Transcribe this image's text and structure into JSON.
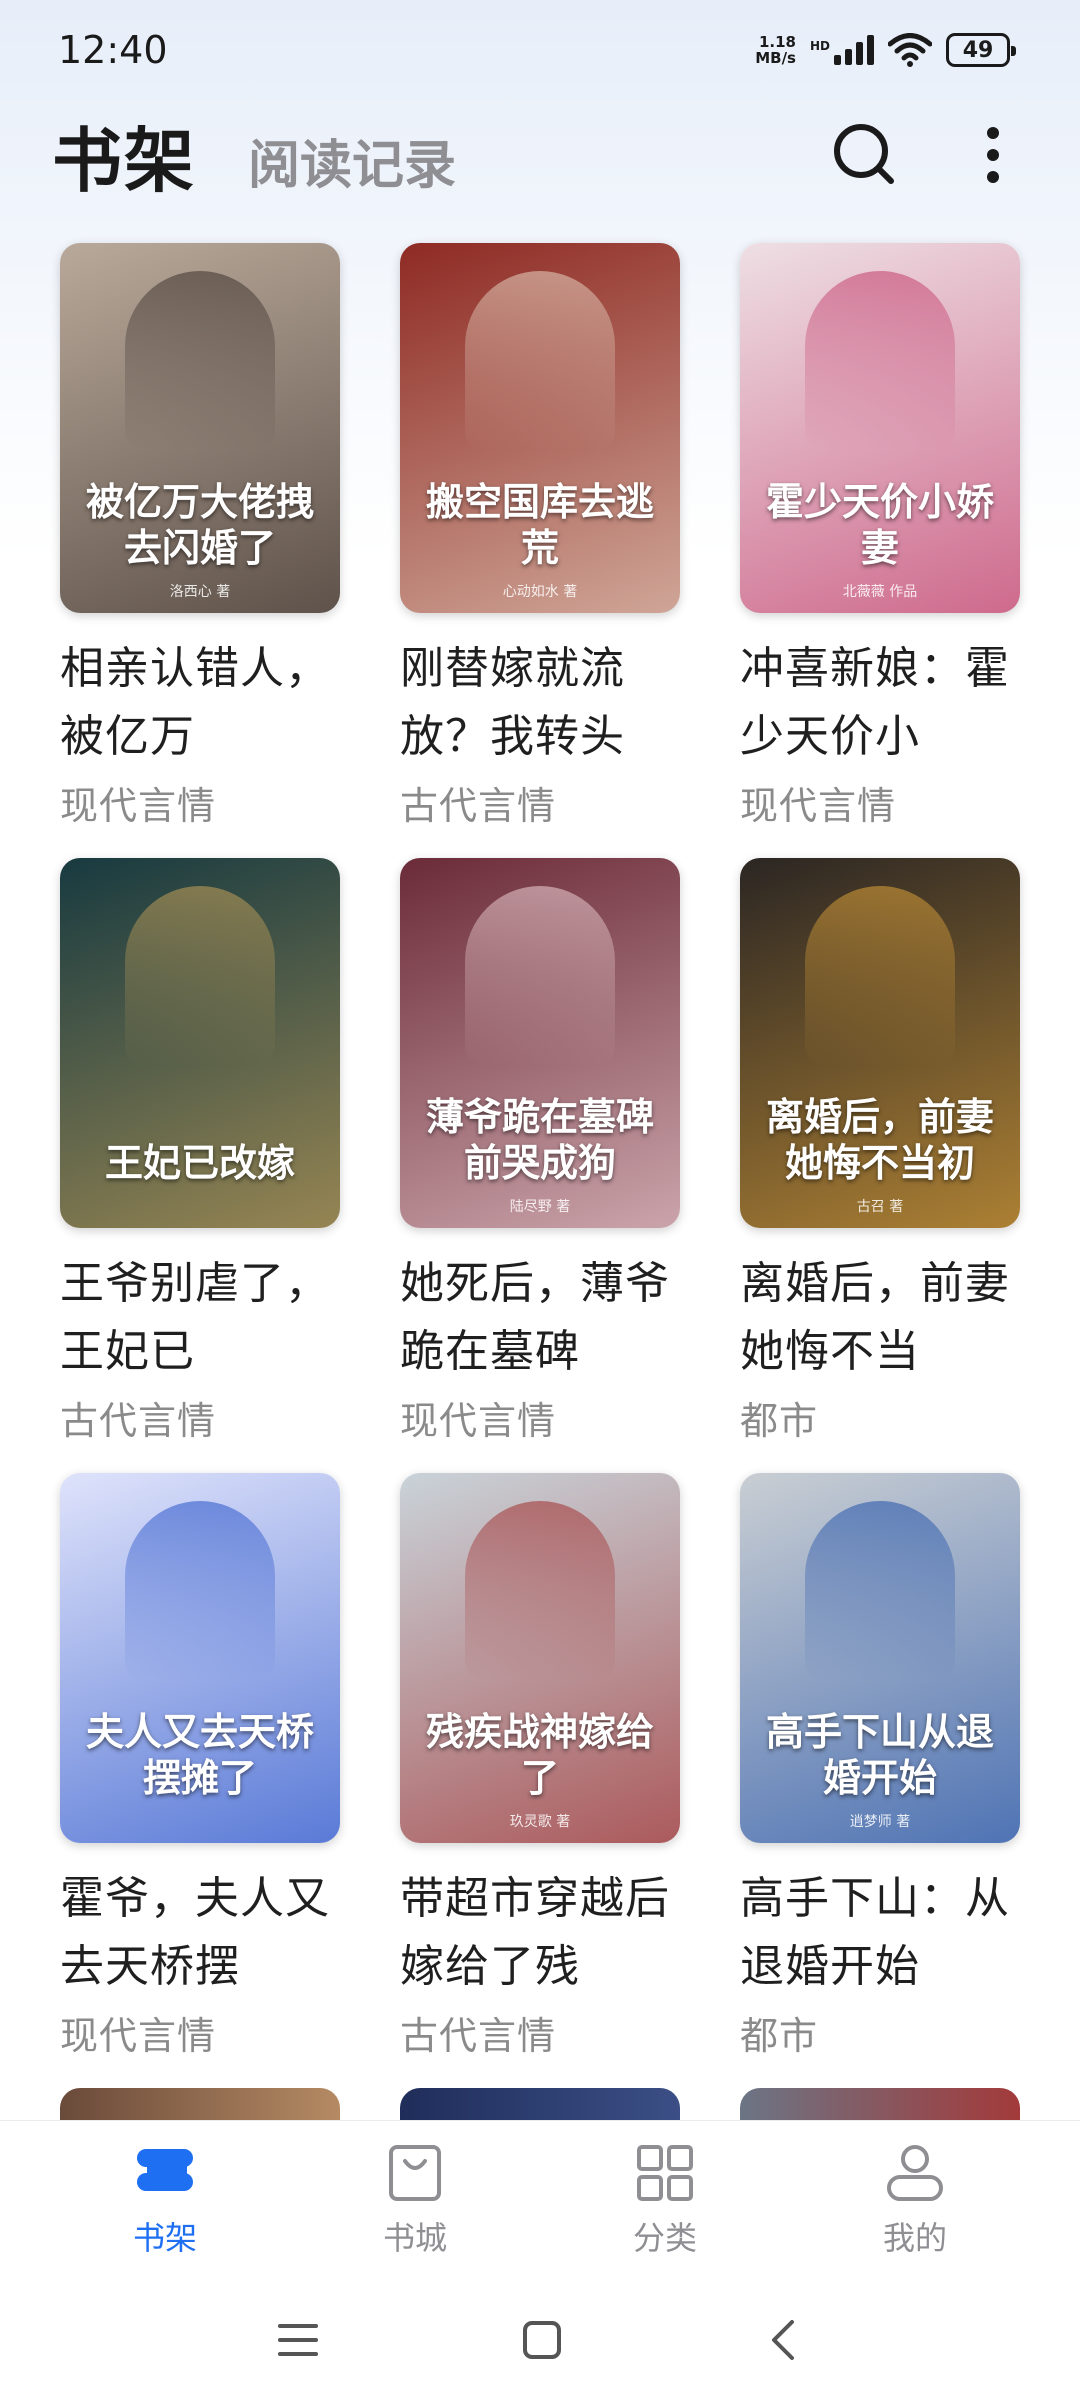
{
  "status_bar": {
    "time": "12:40",
    "net_speed_value": "1.18",
    "net_speed_unit": "MB/s",
    "hd": "HD",
    "battery": "49"
  },
  "header": {
    "tab_active": "书架",
    "tab_inactive": "阅读记录"
  },
  "books": [
    {
      "title": "相亲认错人，被亿万",
      "genre": "现代言情",
      "cover_text": "被亿万大佬拽去闪婚了",
      "cover_author": "洛西心 著",
      "bg": "#b9a99a",
      "accent": "#3a2f2a"
    },
    {
      "title": "刚替嫁就流放？我转头",
      "genre": "古代言情",
      "cover_text": "搬空国库去逃荒",
      "cover_author": "心动如水 著",
      "bg": "#8e2a23",
      "accent": "#e9d7c6"
    },
    {
      "title": "冲喜新娘：霍少天价小",
      "genre": "现代言情",
      "cover_text": "霍少天价小娇妻",
      "cover_author": "北薇薇 作品",
      "bg": "#eedfe4",
      "accent": "#c23b6a"
    },
    {
      "title": "王爷别虐了，王妃已",
      "genre": "古代言情",
      "cover_text": "王妃已改嫁",
      "cover_author": "",
      "bg": "#173a40",
      "accent": "#c9a35a"
    },
    {
      "title": "她死后，薄爷跪在墓碑",
      "genre": "现代言情",
      "cover_text": "薄爷跪在墓碑前哭成狗",
      "cover_author": "陆尽野 著",
      "bg": "#6b2b38",
      "accent": "#f1d4d8"
    },
    {
      "title": "离婚后，前妻她悔不当",
      "genre": "都市",
      "cover_text": "离婚后，前妻她悔不当初",
      "cover_author": "古召 著",
      "bg": "#2b2623",
      "accent": "#e0a43a"
    },
    {
      "title": "霍爷，夫人又去天桥摆",
      "genre": "现代言情",
      "cover_text": "夫人又去天桥摆摊了",
      "cover_author": "",
      "bg": "#dfe3fb",
      "accent": "#2450c8"
    },
    {
      "title": "带超市穿越后嫁给了残",
      "genre": "古代言情",
      "cover_text": "残疾战神嫁给了",
      "cover_author": "玖灵歌 著",
      "bg": "#c9d3d9",
      "accent": "#a02a2a"
    },
    {
      "title": "高手下山：从退婚开始",
      "genre": "都市",
      "cover_text": "高手下山从退婚开始",
      "cover_author": "逍梦师 著",
      "bg": "#c9ced3",
      "accent": "#1e4fa8"
    }
  ],
  "bottom_nav": [
    {
      "label": "书架",
      "icon": "bookshelf-icon",
      "active": true
    },
    {
      "label": "书城",
      "icon": "bag-icon",
      "active": false
    },
    {
      "label": "分类",
      "icon": "grid-icon",
      "active": false
    },
    {
      "label": "我的",
      "icon": "person-icon",
      "active": false
    }
  ],
  "colors": {
    "accent": "#1f6ff2",
    "inactive": "#8e8e93"
  }
}
